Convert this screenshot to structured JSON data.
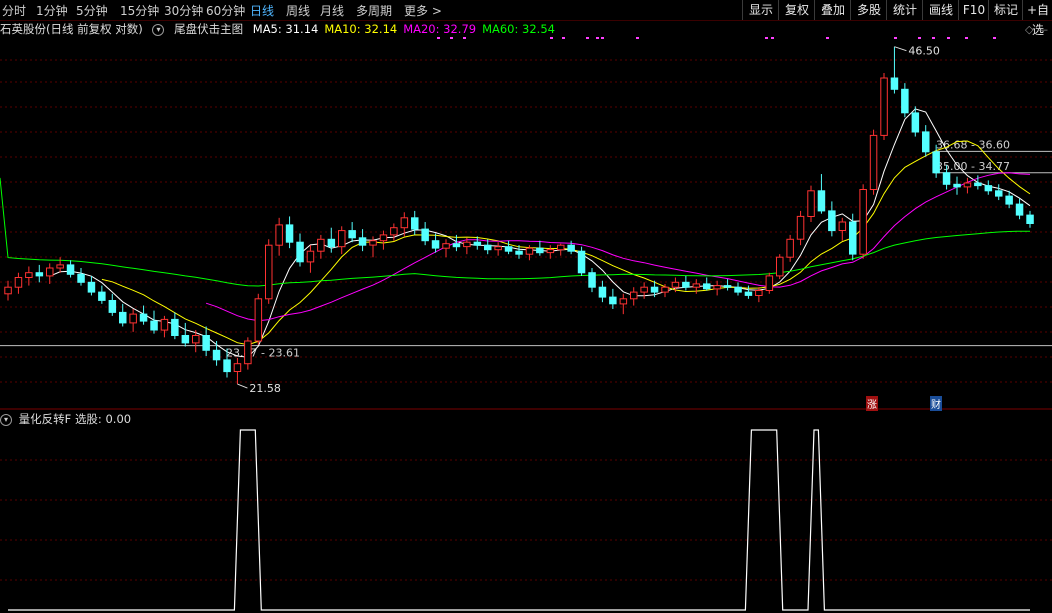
{
  "timeframes": [
    {
      "label": "分时",
      "active": false
    },
    {
      "label": "1分钟",
      "active": false
    },
    {
      "label": "5分钟",
      "active": false
    },
    {
      "label": "15分钟",
      "active": false
    },
    {
      "label": "30分钟",
      "active": false
    },
    {
      "label": "60分钟",
      "active": false
    },
    {
      "label": "日线",
      "active": true
    },
    {
      "label": "周线",
      "active": false
    },
    {
      "label": "月线",
      "active": false
    },
    {
      "label": "多周期",
      "active": false
    },
    {
      "label": "更多 >",
      "active": false
    }
  ],
  "toolbar": [
    "显示",
    "复权",
    "叠加",
    "多股",
    "统计",
    "画线",
    "F10",
    "标记",
    "+自选"
  ],
  "main_header": {
    "stock": "石英股份(日线 前复权 对数)",
    "indicator": "尾盘伏击主图",
    "ma": [
      {
        "label": "MA5: 31.14",
        "color": "#ffffff"
      },
      {
        "label": "MA10: 32.14",
        "color": "#ffff00"
      },
      {
        "label": "MA20: 32.79",
        "color": "#ff00ff"
      },
      {
        "label": "MA60: 32.54",
        "color": "#00ff00"
      }
    ]
  },
  "sub_header": {
    "indicator": "量化反转F",
    "value": "选股: 0.00"
  },
  "markers": {
    "limit_up": "涨",
    "finance": "财"
  },
  "colors": {
    "up": "#ff3232",
    "down": "#54ffff",
    "ma5": "#ffffff",
    "ma10": "#ffff00",
    "ma20": "#ff00ff",
    "ma60": "#00ff00",
    "grid": "#5a0000",
    "level": "#c0c0c0"
  },
  "chart_data": {
    "type": "candlestick",
    "annotations": {
      "high": "46.50",
      "low": "21.58",
      "zones": [
        "36.68 - 36.60",
        "35.00 - 34.77",
        "23.47 - 23.61"
      ]
    },
    "price_range": [
      21.0,
      47.0
    ],
    "ohlc": [
      [
        26.5,
        27.3,
        26.1,
        26.9
      ],
      [
        26.9,
        27.8,
        26.5,
        27.5
      ],
      [
        27.5,
        28.2,
        27.0,
        27.8
      ],
      [
        27.8,
        28.3,
        27.2,
        27.6
      ],
      [
        27.6,
        28.4,
        27.1,
        28.1
      ],
      [
        28.1,
        28.8,
        27.8,
        28.3
      ],
      [
        28.3,
        28.6,
        27.5,
        27.7
      ],
      [
        27.7,
        28.1,
        27.0,
        27.2
      ],
      [
        27.2,
        27.6,
        26.4,
        26.6
      ],
      [
        26.6,
        27.0,
        25.9,
        26.1
      ],
      [
        26.1,
        26.5,
        25.2,
        25.4
      ],
      [
        25.4,
        25.9,
        24.6,
        24.8
      ],
      [
        24.8,
        25.6,
        24.3,
        25.3
      ],
      [
        25.3,
        25.8,
        24.7,
        24.9
      ],
      [
        24.9,
        25.5,
        24.2,
        24.4
      ],
      [
        24.4,
        25.2,
        24.0,
        25.0
      ],
      [
        25.0,
        25.4,
        23.9,
        24.1
      ],
      [
        24.1,
        24.8,
        23.5,
        23.7
      ],
      [
        23.7,
        24.4,
        23.2,
        24.1
      ],
      [
        24.1,
        24.6,
        23.0,
        23.3
      ],
      [
        23.3,
        23.8,
        22.5,
        22.8
      ],
      [
        22.8,
        23.4,
        21.9,
        22.2
      ],
      [
        22.2,
        22.9,
        21.58,
        22.6
      ],
      [
        22.6,
        24.0,
        22.3,
        23.8
      ],
      [
        23.8,
        26.5,
        23.6,
        26.2
      ],
      [
        26.2,
        30.0,
        25.9,
        29.6
      ],
      [
        29.6,
        31.5,
        28.9,
        31.0
      ],
      [
        31.0,
        31.6,
        29.4,
        29.8
      ],
      [
        29.8,
        30.4,
        28.2,
        28.5
      ],
      [
        28.5,
        29.6,
        27.8,
        29.2
      ],
      [
        29.2,
        30.3,
        28.7,
        30.0
      ],
      [
        30.0,
        30.8,
        29.1,
        29.5
      ],
      [
        29.5,
        30.9,
        29.0,
        30.6
      ],
      [
        30.6,
        31.2,
        29.8,
        30.1
      ],
      [
        30.1,
        30.7,
        29.2,
        29.6
      ],
      [
        29.6,
        30.2,
        28.8,
        29.9
      ],
      [
        29.9,
        30.6,
        29.3,
        30.3
      ],
      [
        30.3,
        31.1,
        29.9,
        30.8
      ],
      [
        30.8,
        31.9,
        30.2,
        31.5
      ],
      [
        31.5,
        32.0,
        30.3,
        30.7
      ],
      [
        30.7,
        31.2,
        29.6,
        29.9
      ],
      [
        29.9,
        30.4,
        29.1,
        29.4
      ],
      [
        29.4,
        30.0,
        28.8,
        29.7
      ],
      [
        29.7,
        30.3,
        29.2,
        29.5
      ],
      [
        29.5,
        30.1,
        29.0,
        29.8
      ],
      [
        29.8,
        30.2,
        29.3,
        29.6
      ],
      [
        29.6,
        30.0,
        29.0,
        29.3
      ],
      [
        29.3,
        29.8,
        28.9,
        29.5
      ],
      [
        29.5,
        29.9,
        29.0,
        29.2
      ],
      [
        29.2,
        29.6,
        28.7,
        29.0
      ],
      [
        29.0,
        29.6,
        28.6,
        29.4
      ],
      [
        29.4,
        29.9,
        28.9,
        29.1
      ],
      [
        29.1,
        29.6,
        28.7,
        29.3
      ],
      [
        29.3,
        29.7,
        28.9,
        29.6
      ],
      [
        29.6,
        29.9,
        29.0,
        29.2
      ],
      [
        29.2,
        29.5,
        27.6,
        27.8
      ],
      [
        27.8,
        28.1,
        26.6,
        26.9
      ],
      [
        26.9,
        27.3,
        26.0,
        26.3
      ],
      [
        26.3,
        26.8,
        25.6,
        25.9
      ],
      [
        25.9,
        26.5,
        25.3,
        26.2
      ],
      [
        26.2,
        26.9,
        25.8,
        26.6
      ],
      [
        26.6,
        27.2,
        26.2,
        26.9
      ],
      [
        26.9,
        27.3,
        26.3,
        26.6
      ],
      [
        26.6,
        27.1,
        26.3,
        26.9
      ],
      [
        26.9,
        27.5,
        26.6,
        27.2
      ],
      [
        27.2,
        27.6,
        26.7,
        26.9
      ],
      [
        26.9,
        27.4,
        26.5,
        27.1
      ],
      [
        27.1,
        27.5,
        26.7,
        26.8
      ],
      [
        26.8,
        27.3,
        26.4,
        27.0
      ],
      [
        27.0,
        27.4,
        26.7,
        26.9
      ],
      [
        26.9,
        27.2,
        26.4,
        26.6
      ],
      [
        26.6,
        27.0,
        26.2,
        26.4
      ],
      [
        26.4,
        26.9,
        26.0,
        26.7
      ],
      [
        26.7,
        27.8,
        26.5,
        27.6
      ],
      [
        27.6,
        29.0,
        27.4,
        28.8
      ],
      [
        28.8,
        30.3,
        28.5,
        30.0
      ],
      [
        30.0,
        32.0,
        29.6,
        31.6
      ],
      [
        31.6,
        33.9,
        31.2,
        33.5
      ],
      [
        33.5,
        34.8,
        31.8,
        32.0
      ],
      [
        32.0,
        32.7,
        30.2,
        30.6
      ],
      [
        30.6,
        31.5,
        29.9,
        31.2
      ],
      [
        31.2,
        31.8,
        28.6,
        29.0
      ],
      [
        29.0,
        34.0,
        28.7,
        33.6
      ],
      [
        33.6,
        38.5,
        33.2,
        38.0
      ],
      [
        38.0,
        43.8,
        37.6,
        43.3
      ],
      [
        43.3,
        46.5,
        41.8,
        42.2
      ],
      [
        42.2,
        42.8,
        39.6,
        40.0
      ],
      [
        40.0,
        40.6,
        37.9,
        38.3
      ],
      [
        38.3,
        38.9,
        36.2,
        36.6
      ],
      [
        36.6,
        37.2,
        34.5,
        34.9
      ],
      [
        34.9,
        35.5,
        33.6,
        34.0
      ],
      [
        34.0,
        34.6,
        33.2,
        33.8
      ],
      [
        33.8,
        34.5,
        33.3,
        34.1
      ],
      [
        34.1,
        34.7,
        33.6,
        33.9
      ],
      [
        33.9,
        34.3,
        33.2,
        33.5
      ],
      [
        33.5,
        34.0,
        32.8,
        33.1
      ],
      [
        33.1,
        33.5,
        32.2,
        32.5
      ],
      [
        32.5,
        32.9,
        31.4,
        31.7
      ],
      [
        31.7,
        32.0,
        30.8,
        31.1
      ]
    ],
    "selection_signal": [
      0,
      0,
      0,
      0,
      0,
      0,
      0,
      0,
      0,
      0,
      0,
      0,
      0,
      0,
      0,
      0,
      0,
      0,
      0,
      0,
      0,
      0,
      1,
      1,
      0,
      0,
      0,
      0,
      0,
      0,
      0,
      0,
      0,
      0,
      0,
      0,
      0,
      0,
      0,
      0,
      0,
      0,
      0,
      0,
      0,
      0,
      0,
      0,
      0,
      0,
      0,
      0,
      0,
      0,
      0,
      0,
      0,
      0,
      0,
      0,
      0,
      0,
      0,
      0,
      0,
      0,
      0,
      0,
      0,
      0,
      0,
      1,
      1,
      1,
      0,
      0,
      0,
      1,
      0,
      0,
      0,
      0,
      0,
      0,
      0,
      0,
      0,
      0,
      0,
      0,
      0,
      0,
      0,
      0,
      0,
      0,
      0,
      0,
      0
    ]
  }
}
